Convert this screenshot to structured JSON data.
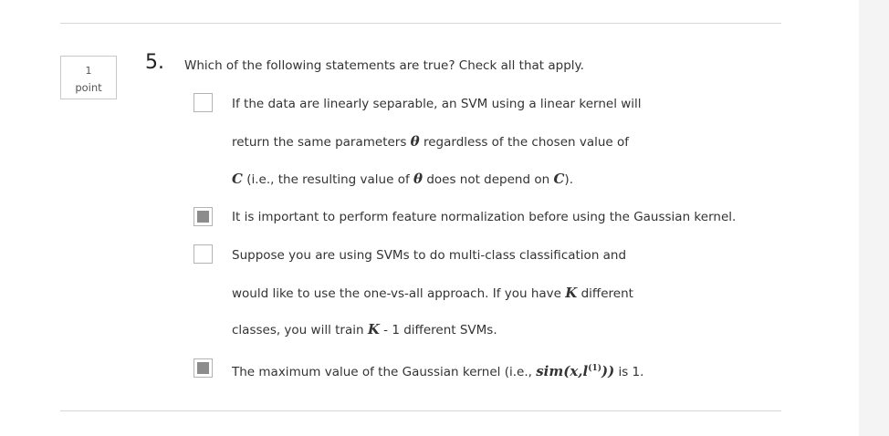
{
  "question": {
    "points_value": "1",
    "points_label": "point",
    "number": "5.",
    "prompt": "Which of the following statements are true? Check all that apply."
  },
  "options": [
    {
      "checked": false,
      "lines": [
        {
          "pre": "If the data are linearly separable, an SVM using a linear kernel will"
        },
        {
          "pre": "return the same parameters ",
          "math1": "θ",
          "post": " regardless of the chosen value of"
        },
        {
          "math0": "C",
          "pre": " (i.e., the resulting value of ",
          "math1": "θ",
          "mid": " does not depend on ",
          "math2": "C",
          "post": ")."
        }
      ]
    },
    {
      "checked": true,
      "lines": [
        {
          "pre": "It is important to perform feature normalization before using the Gaussian kernel."
        }
      ]
    },
    {
      "checked": false,
      "lines": [
        {
          "pre": "Suppose you are using SVMs to do multi-class classification and"
        },
        {
          "pre": "would like to use the one-vs-all approach. If you have ",
          "math1": "K",
          "post": " different"
        },
        {
          "pre": "classes, you will train ",
          "math1": "K",
          "post": " - 1 different SVMs."
        }
      ]
    },
    {
      "checked": true,
      "lines": [
        {
          "pre": "The maximum value of the Gaussian kernel (i.e., ",
          "math1": "sim(x,l",
          "sup": "(1)",
          "math_close": "))",
          "post": " is 1."
        }
      ]
    }
  ]
}
